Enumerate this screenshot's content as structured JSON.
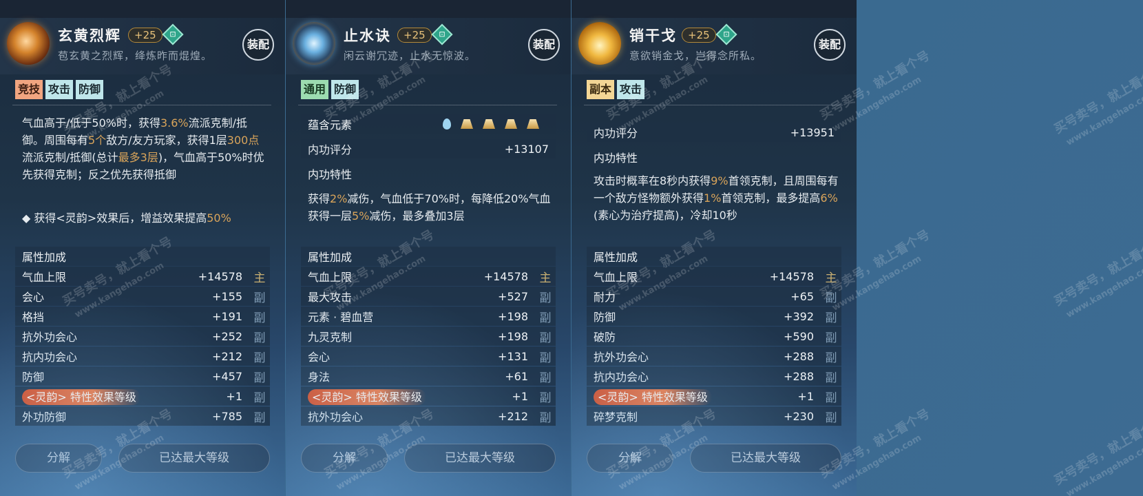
{
  "cards": [
    {
      "title": "玄黄烈辉",
      "level": "+25",
      "subtitle": "苞玄黄之烈辉，绛炼昨而焜煌。",
      "equip_label": "装配",
      "tags": [
        "竞技",
        "攻击",
        "防御"
      ],
      "desc_parts": [
        [
          "气血高于/低于50%时，获得",
          false
        ],
        [
          "3.6%",
          true
        ],
        [
          "流派克制/抵御。周围每有",
          false
        ],
        [
          "5个",
          true
        ],
        [
          "敌方/友方玩家，获得1层",
          false
        ],
        [
          "300点",
          true
        ],
        [
          "流派克制/抵御(总计",
          false
        ],
        [
          "最多3层",
          true
        ],
        [
          ")，气血高于50%时优先获得克制；反之优先获得抵御",
          false
        ]
      ],
      "desc_bullet_parts": [
        [
          "◆ 获得<灵韵>效果后，增益效果提高",
          false
        ],
        [
          "50%",
          true
        ]
      ],
      "section_label": "属性加成",
      "stats": [
        {
          "label": "气血上限",
          "value": "+14578",
          "kind": "主"
        },
        {
          "label": "会心",
          "value": "+155",
          "kind": "副"
        },
        {
          "label": "格挡",
          "value": "+191",
          "kind": "副"
        },
        {
          "label": "抗外功会心",
          "value": "+252",
          "kind": "副"
        },
        {
          "label": "抗内功会心",
          "value": "+212",
          "kind": "副"
        },
        {
          "label": "防御",
          "value": "+457",
          "kind": "副"
        },
        {
          "label": "<灵韵> 特性效果等级",
          "value": "+1",
          "kind": "副",
          "special": true
        },
        {
          "label": "外功防御",
          "value": "+785",
          "kind": "副"
        }
      ],
      "btn_decompose": "分解",
      "btn_max": "已达最大等级"
    },
    {
      "title": "止水诀",
      "level": "+25",
      "subtitle": "闲云谢冗迹，止水无惊波。",
      "equip_label": "装配",
      "tags": [
        "通用",
        "防御"
      ],
      "element_label": "蕴含元素",
      "score_label": "内功评分",
      "score_value": "+13107",
      "trait_label": "内功特性",
      "desc_parts": [
        [
          "获得",
          false
        ],
        [
          "2%",
          true
        ],
        [
          "减伤，气血低于70%时，每降低20%气血获得一层",
          false
        ],
        [
          "5%",
          true
        ],
        [
          "减伤，最多叠加3层",
          false
        ]
      ],
      "section_label": "属性加成",
      "stats": [
        {
          "label": "气血上限",
          "value": "+14578",
          "kind": "主"
        },
        {
          "label": "最大攻击",
          "value": "+527",
          "kind": "副"
        },
        {
          "label": "元素 · 碧血营",
          "value": "+198",
          "kind": "副"
        },
        {
          "label": "九灵克制",
          "value": "+198",
          "kind": "副"
        },
        {
          "label": "会心",
          "value": "+131",
          "kind": "副"
        },
        {
          "label": "身法",
          "value": "+61",
          "kind": "副"
        },
        {
          "label": "<灵韵> 特性效果等级",
          "value": "+1",
          "kind": "副",
          "special": true
        },
        {
          "label": "抗外功会心",
          "value": "+212",
          "kind": "副"
        }
      ],
      "btn_decompose": "分解",
      "btn_max": "已达最大等级"
    },
    {
      "title": "销干戈",
      "level": "+25",
      "subtitle": "意欲销金戈，岂得念所私。",
      "equip_label": "装配",
      "tags": [
        "副本",
        "攻击"
      ],
      "score_label": "内功评分",
      "score_value": "+13951",
      "trait_label": "内功特性",
      "desc_parts": [
        [
          "攻击时概率在8秒内获得",
          false
        ],
        [
          "9%",
          true
        ],
        [
          "首领克制，且周围每有一个敌方怪物额外获得",
          false
        ],
        [
          "1%",
          true
        ],
        [
          "首领克制，最多提高",
          false
        ],
        [
          "6%",
          true
        ],
        [
          "(素心为治疗提高)，冷却10秒",
          false
        ]
      ],
      "section_label": "属性加成",
      "stats": [
        {
          "label": "气血上限",
          "value": "+14578",
          "kind": "主"
        },
        {
          "label": "耐力",
          "value": "+65",
          "kind": "副"
        },
        {
          "label": "防御",
          "value": "+392",
          "kind": "副"
        },
        {
          "label": "破防",
          "value": "+590",
          "kind": "副"
        },
        {
          "label": "抗外功会心",
          "value": "+288",
          "kind": "副"
        },
        {
          "label": "抗内功会心",
          "value": "+288",
          "kind": "副"
        },
        {
          "label": "<灵韵> 特性效果等级",
          "value": "+1",
          "kind": "副",
          "special": true
        },
        {
          "label": "碎梦克制",
          "value": "+230",
          "kind": "副"
        }
      ],
      "btn_decompose": "分解",
      "btn_max": "已达最大等级"
    }
  ],
  "watermark_text": "买号卖号，就上看个号",
  "watermark_url": "www.kangehao.com"
}
